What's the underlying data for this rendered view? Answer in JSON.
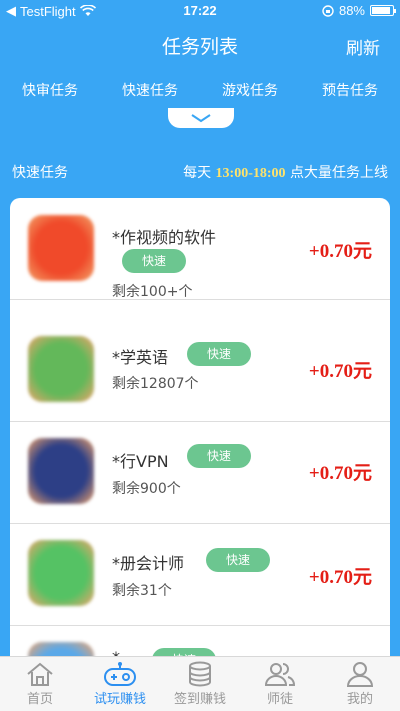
{
  "status_bar": {
    "carrier": "TestFlight",
    "time": "17:22",
    "battery": "88%",
    "battery_level": 0.88
  },
  "header": {
    "title": "任务列表",
    "refresh_label": "刷新"
  },
  "tabs": [
    "快审任务",
    "快速任务",
    "游戏任务",
    "预告任务"
  ],
  "banner": {
    "section_label": "快速任务",
    "prefix": "每天 ",
    "time_range": "13:00-18:00",
    "suffix": " 点大量任务上线"
  },
  "tasks": [
    {
      "name": "*作视频的软件",
      "tag": "快速",
      "remaining": "剩余100+个",
      "reward": "+0.70元",
      "icon_color": "#f04a2a"
    },
    {
      "name": "*学英语",
      "tag": "快速",
      "remaining": "剩余12807个",
      "reward": "+0.70元",
      "icon_color": "#63b85a"
    },
    {
      "name": "*行VPN",
      "tag": "快速",
      "remaining": "剩余900个",
      "reward": "+0.70元",
      "icon_color": "#2d3f86"
    },
    {
      "name": "*册会计师",
      "tag": "快速",
      "remaining": "剩余31个",
      "reward": "+0.70元",
      "icon_color": "#55c264"
    },
    {
      "name": "*",
      "tag": "快速",
      "remaining": "",
      "reward": "",
      "icon_color": "#5aa8e8"
    }
  ],
  "tabbar": [
    {
      "label": "首页",
      "icon": "home-icon",
      "active": false
    },
    {
      "label": "试玩赚钱",
      "icon": "gamepad-icon",
      "active": true
    },
    {
      "label": "签到赚钱",
      "icon": "coins-icon",
      "active": false
    },
    {
      "label": "师徒",
      "icon": "users-icon",
      "active": false
    },
    {
      "label": "我的",
      "icon": "user-icon",
      "active": false
    }
  ]
}
